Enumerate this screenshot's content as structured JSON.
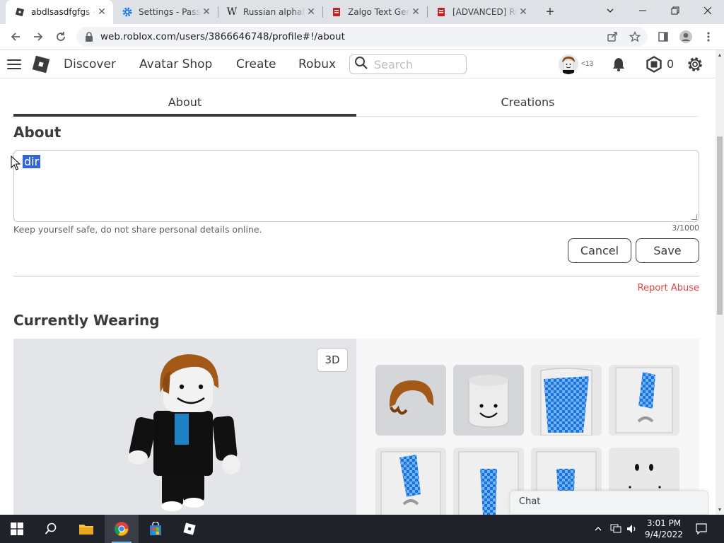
{
  "browser": {
    "tabs": [
      {
        "title": "abdlsasdfgfgs -",
        "active": true,
        "favicon": "roblox-favicon-icon"
      },
      {
        "title": "Settings - Passw",
        "active": false,
        "favicon": "gear-icon"
      },
      {
        "title": "Russian alphabe",
        "active": false,
        "favicon": "wikipedia-icon"
      },
      {
        "title": "Zalgo Text Gene",
        "active": false,
        "favicon": "document-red-icon"
      },
      {
        "title": "[ADVANCED] Ro",
        "active": false,
        "favicon": "document-red-icon"
      }
    ],
    "url": "web.roblox.com/users/3866646748/profile#!/about"
  },
  "header": {
    "nav": [
      "Discover",
      "Avatar Shop",
      "Create",
      "Robux"
    ],
    "search_placeholder": "Search",
    "age_label": "<13",
    "robux": "0"
  },
  "profile": {
    "tabs": [
      "About",
      "Creations"
    ],
    "active_tab": "About",
    "about_heading": "About",
    "bio_text": "dir",
    "safety_note": "Keep yourself safe, do not share personal details online.",
    "char_count": "3/1000",
    "cancel_label": "Cancel",
    "save_label": "Save",
    "report_label": "Report Abuse",
    "wearing_heading": "Currently Wearing",
    "toggle_3d_label": "3D",
    "chat_label": "Chat"
  },
  "taskbar": {
    "time": "3:01 PM",
    "date": "9/4/2022"
  },
  "colors": {
    "accent_red": "#e0443c",
    "selection": "#3367d6",
    "text": "#393b3d"
  }
}
